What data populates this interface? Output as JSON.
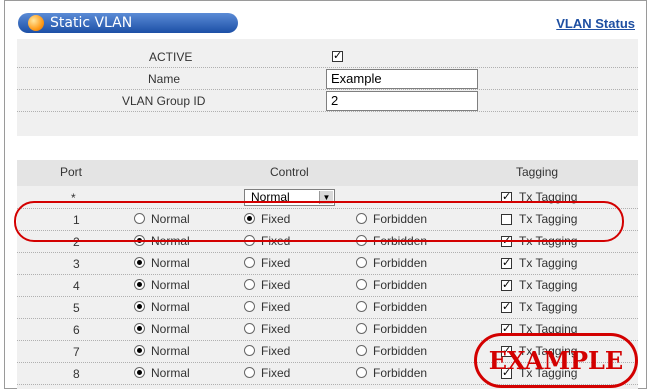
{
  "header": {
    "title": "Static VLAN",
    "status_link": "VLAN Status"
  },
  "form": {
    "active_label": "ACTIVE",
    "active_checked": true,
    "name_label": "Name",
    "name_value": "Example",
    "group_id_label": "VLAN Group ID",
    "group_id_value": "2"
  },
  "ports_table": {
    "columns": [
      "Port",
      "Control",
      "Tagging"
    ],
    "radio_labels": [
      "Normal",
      "Fixed",
      "Forbidden"
    ],
    "tag_label": "Tx Tagging",
    "all_row": {
      "port": "*",
      "control_select": "Normal",
      "tx_checked": true
    },
    "rows": [
      {
        "port": "1",
        "control": "Fixed",
        "tx_checked": false
      },
      {
        "port": "2",
        "control": "Normal",
        "tx_checked": true
      },
      {
        "port": "3",
        "control": "Normal",
        "tx_checked": true
      },
      {
        "port": "4",
        "control": "Normal",
        "tx_checked": true
      },
      {
        "port": "5",
        "control": "Normal",
        "tx_checked": true
      },
      {
        "port": "6",
        "control": "Normal",
        "tx_checked": true
      },
      {
        "port": "7",
        "control": "Normal",
        "tx_checked": true
      },
      {
        "port": "8",
        "control": "Normal",
        "tx_checked": true
      }
    ]
  },
  "stamp": {
    "text": "EXAMPLE"
  },
  "colors": {
    "accent": "#1e4fa2",
    "highlight": "#d30000"
  }
}
